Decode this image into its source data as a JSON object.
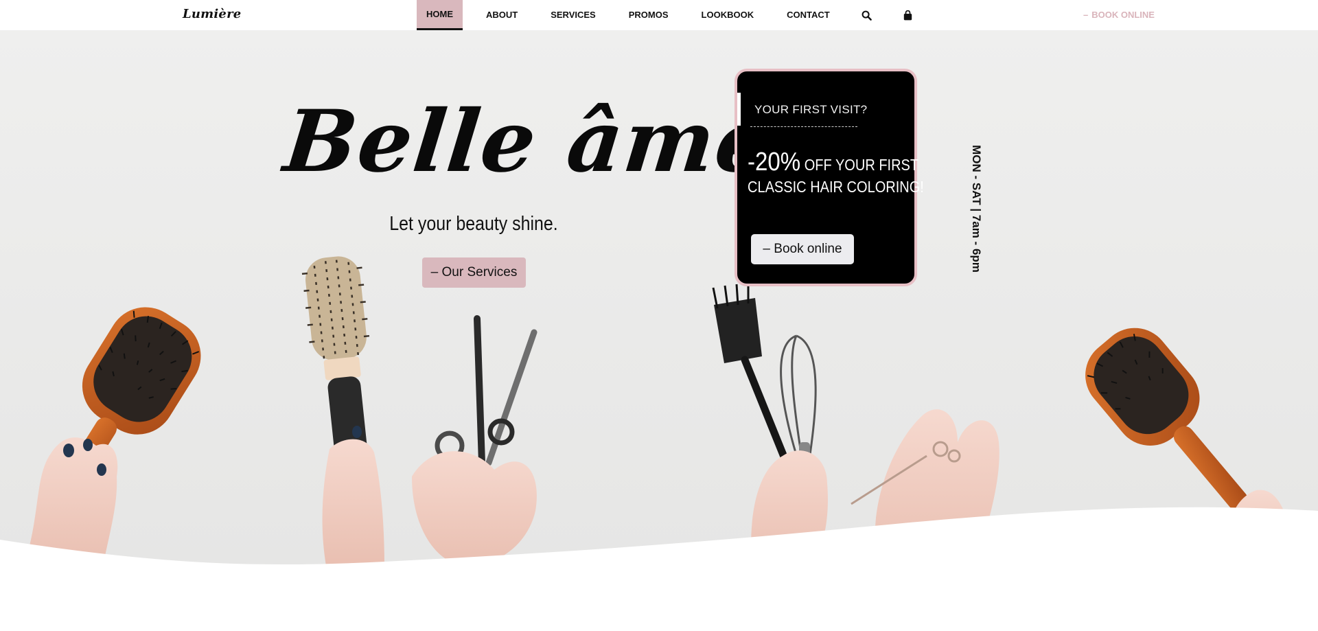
{
  "header": {
    "logo": "Lumière",
    "nav": [
      {
        "label": "HOME",
        "active": true
      },
      {
        "label": "ABOUT"
      },
      {
        "label": "SERVICES"
      },
      {
        "label": "PROMOS"
      },
      {
        "label": "LOOKBOOK"
      },
      {
        "label": "CONTACT"
      }
    ],
    "icons": [
      "search-icon",
      "shopping-bag-icon"
    ],
    "book_online": "BOOK ONLINE",
    "book_online_prefix": "–"
  },
  "hero": {
    "title": "Belle âme",
    "tagline": "Let your beauty shine.",
    "services_button": "– Our Services",
    "hours": "MON - SAT | 7am - 6pm",
    "image": "hands holding hair brushes, scissors, a dye brush and whisk"
  },
  "promo": {
    "kicker": "YOUR FIRST VISIT?",
    "percent": "-20%",
    "line1": "OFF YOUR FIRST",
    "line2": "CLASSIC HAIR COLORING!",
    "button": "– Book online"
  },
  "colors": {
    "accent_pink": "#d9b8bd",
    "card_border": "#e7bfc5",
    "book_online_text": "#d9b4bb",
    "text": "#111111"
  }
}
